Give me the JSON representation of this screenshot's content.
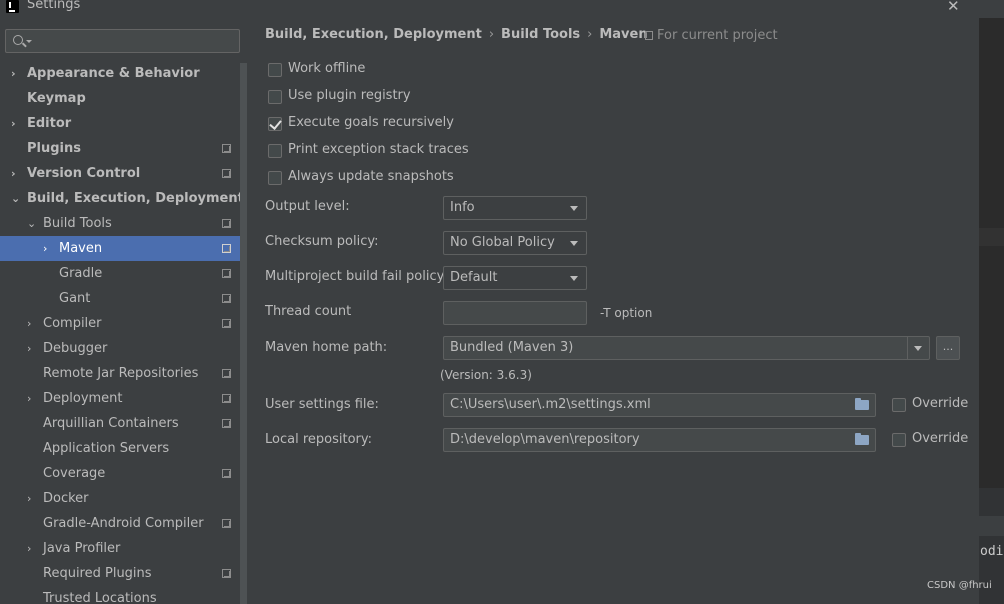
{
  "window": {
    "title": "Settings",
    "close_glyph": "✕"
  },
  "search": {
    "value": ""
  },
  "sidebar": {
    "items": [
      {
        "label": "Appearance & Behavior",
        "arrow": "›",
        "bold": true,
        "copy": false
      },
      {
        "label": "Keymap",
        "arrow": "",
        "bold": true,
        "copy": false
      },
      {
        "label": "Editor",
        "arrow": "›",
        "bold": true,
        "copy": false
      },
      {
        "label": "Plugins",
        "arrow": "",
        "bold": true,
        "copy": true
      },
      {
        "label": "Version Control",
        "arrow": "›",
        "bold": true,
        "copy": true
      },
      {
        "label": "Build, Execution, Deployment",
        "arrow": "⌄",
        "bold": true,
        "copy": false
      },
      {
        "label": "Build Tools",
        "arrow": "⌄",
        "bold": false,
        "copy": true
      },
      {
        "label": "Maven",
        "arrow": "›",
        "bold": false,
        "copy": true,
        "selected": true
      },
      {
        "label": "Gradle",
        "arrow": "",
        "bold": false,
        "copy": true
      },
      {
        "label": "Gant",
        "arrow": "",
        "bold": false,
        "copy": true
      },
      {
        "label": "Compiler",
        "arrow": "›",
        "bold": false,
        "copy": true
      },
      {
        "label": "Debugger",
        "arrow": "›",
        "bold": false,
        "copy": false
      },
      {
        "label": "Remote Jar Repositories",
        "arrow": "",
        "bold": false,
        "copy": true
      },
      {
        "label": "Deployment",
        "arrow": "›",
        "bold": false,
        "copy": true
      },
      {
        "label": "Arquillian Containers",
        "arrow": "",
        "bold": false,
        "copy": true
      },
      {
        "label": "Application Servers",
        "arrow": "",
        "bold": false,
        "copy": false
      },
      {
        "label": "Coverage",
        "arrow": "",
        "bold": false,
        "copy": true
      },
      {
        "label": "Docker",
        "arrow": "›",
        "bold": false,
        "copy": false
      },
      {
        "label": "Gradle-Android Compiler",
        "arrow": "",
        "bold": false,
        "copy": true
      },
      {
        "label": "Java Profiler",
        "arrow": "›",
        "bold": false,
        "copy": false
      },
      {
        "label": "Required Plugins",
        "arrow": "",
        "bold": false,
        "copy": true
      },
      {
        "label": "Trusted Locations",
        "arrow": "",
        "bold": false,
        "copy": false
      }
    ]
  },
  "breadcrumb": {
    "items": [
      "Build, Execution, Deployment",
      "Build Tools",
      "Maven"
    ],
    "separator": "›"
  },
  "scope": {
    "label": "For current project"
  },
  "checkboxes": [
    {
      "label": "Work offline",
      "checked": false
    },
    {
      "label": "Use plugin registry",
      "checked": false
    },
    {
      "label": "Execute goals recursively",
      "checked": true
    },
    {
      "label": "Print exception stack traces",
      "checked": false
    },
    {
      "label": "Always update snapshots",
      "checked": false
    }
  ],
  "form": {
    "output_level": {
      "label": "Output level:",
      "value": "Info"
    },
    "checksum_policy": {
      "label": "Checksum policy:",
      "value": "No Global Policy"
    },
    "fail_policy": {
      "label": "Multiproject build fail policy:",
      "value": "Default"
    },
    "thread_count": {
      "label": "Thread count",
      "value": "",
      "hint": "-T option"
    },
    "maven_home": {
      "label": "Maven home path:",
      "value": "Bundled (Maven 3)",
      "browse": "...",
      "version": "(Version: 3.6.3)"
    },
    "user_settings": {
      "label": "User settings file:",
      "value": "C:\\Users\\user\\.m2\\settings.xml",
      "override": "Override",
      "override_checked": false
    },
    "local_repo": {
      "label": "Local repository:",
      "value": "D:\\develop\\maven\\repository",
      "override": "Override",
      "override_checked": false
    }
  },
  "background_window": {
    "text": "odi"
  },
  "watermark": {
    "text": "CSDN @fhrui"
  },
  "colors": {
    "selection": "#4b6eaf",
    "background": "#3c3f41",
    "text": "#bbbbbb"
  }
}
